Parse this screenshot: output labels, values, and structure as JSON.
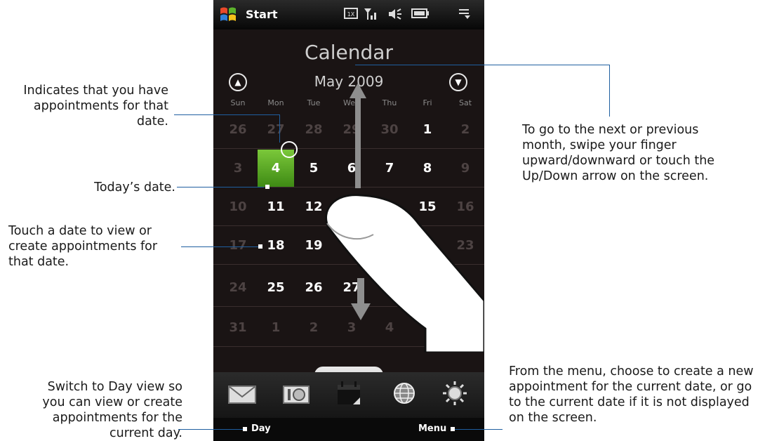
{
  "status_bar": {
    "start_label": "Start",
    "icons": [
      "windows-logo-icon",
      "network-1x-icon",
      "signal-icon",
      "volume-icon",
      "battery-icon",
      "menu-icon"
    ]
  },
  "calendar": {
    "title": "Calendar",
    "month_label": "May 2009",
    "weekdays": [
      "Sun",
      "Mon",
      "Tue",
      "Wed",
      "Thu",
      "Fri",
      "Sat"
    ],
    "weeks": [
      [
        {
          "d": "26",
          "m": "out"
        },
        {
          "d": "27",
          "m": "out"
        },
        {
          "d": "28",
          "m": "out"
        },
        {
          "d": "29",
          "m": "out"
        },
        {
          "d": "30",
          "m": "out"
        },
        {
          "d": "1",
          "m": "in"
        },
        {
          "d": "2",
          "m": "out"
        }
      ],
      [
        {
          "d": "3",
          "m": "out"
        },
        {
          "d": "4",
          "m": "today"
        },
        {
          "d": "5",
          "m": "in"
        },
        {
          "d": "6",
          "m": "in"
        },
        {
          "d": "7",
          "m": "in"
        },
        {
          "d": "8",
          "m": "in"
        },
        {
          "d": "9",
          "m": "out"
        }
      ],
      [
        {
          "d": "10",
          "m": "out"
        },
        {
          "d": "11",
          "m": "in"
        },
        {
          "d": "12",
          "m": "in"
        },
        {
          "d": "",
          "m": "in"
        },
        {
          "d": "",
          "m": "in"
        },
        {
          "d": "15",
          "m": "in"
        },
        {
          "d": "16",
          "m": "out"
        }
      ],
      [
        {
          "d": "17",
          "m": "out"
        },
        {
          "d": "18",
          "m": "in"
        },
        {
          "d": "19",
          "m": "in"
        },
        {
          "d": "",
          "m": "in"
        },
        {
          "d": "",
          "m": "in"
        },
        {
          "d": "",
          "m": "in"
        },
        {
          "d": "23",
          "m": "out"
        }
      ],
      [
        {
          "d": "24",
          "m": "out"
        },
        {
          "d": "25",
          "m": "in"
        },
        {
          "d": "26",
          "m": "in"
        },
        {
          "d": "27",
          "m": "in"
        },
        {
          "d": "",
          "m": "in"
        },
        {
          "d": "",
          "m": "in"
        },
        {
          "d": "",
          "m": "out"
        }
      ],
      [
        {
          "d": "31",
          "m": "out"
        },
        {
          "d": "1",
          "m": "out"
        },
        {
          "d": "2",
          "m": "out"
        },
        {
          "d": "3",
          "m": "out"
        },
        {
          "d": "4",
          "m": "out"
        },
        {
          "d": "",
          "m": "out"
        },
        {
          "d": "",
          "m": "out"
        }
      ]
    ]
  },
  "bottom_tabs": [
    "mail-icon",
    "camera-icon",
    "calendar-icon",
    "internet-icon",
    "settings-icon"
  ],
  "softkeys": {
    "left": "Day",
    "right": "Menu"
  },
  "annotations": {
    "appointments": "Indicates that you have appointments for that date.",
    "today": "Today’s date.",
    "touch_date": "Touch a date to view or create appointments for that date.",
    "switch_day": "Switch to Day view so you can view or create appointments for the current day.",
    "next_month": "To go to the next or previous month, swipe your finger upward/downward or touch the Up/Down arrow on the screen.",
    "menu": "From the menu, choose to create a new appointment for the current date, or go to the current date if it is not displayed on the screen."
  },
  "colors": {
    "accent_green": "#5aa824",
    "leader_line": "#1f5fa0",
    "screen_bg": "#1a1414"
  }
}
